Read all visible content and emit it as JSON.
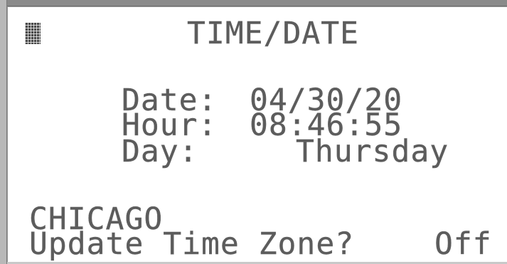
{
  "screen": {
    "title": "TIME/DATE",
    "menu_icon": "block-cursor-icon"
  },
  "fields": {
    "date_label": "Date:",
    "date_value": "04/30/20",
    "hour_label": "Hour:",
    "hour_value": "08:46:55",
    "day_label": "Day:",
    "day_value": "Thursday"
  },
  "footer": {
    "city": "CHICAGO",
    "update_label": "Update Time Zone?",
    "update_value": "Off"
  },
  "colors": {
    "lcd_text": "#5c5c5c",
    "lcd_background": "#ffffff",
    "bezel": "#8a8a8a"
  }
}
